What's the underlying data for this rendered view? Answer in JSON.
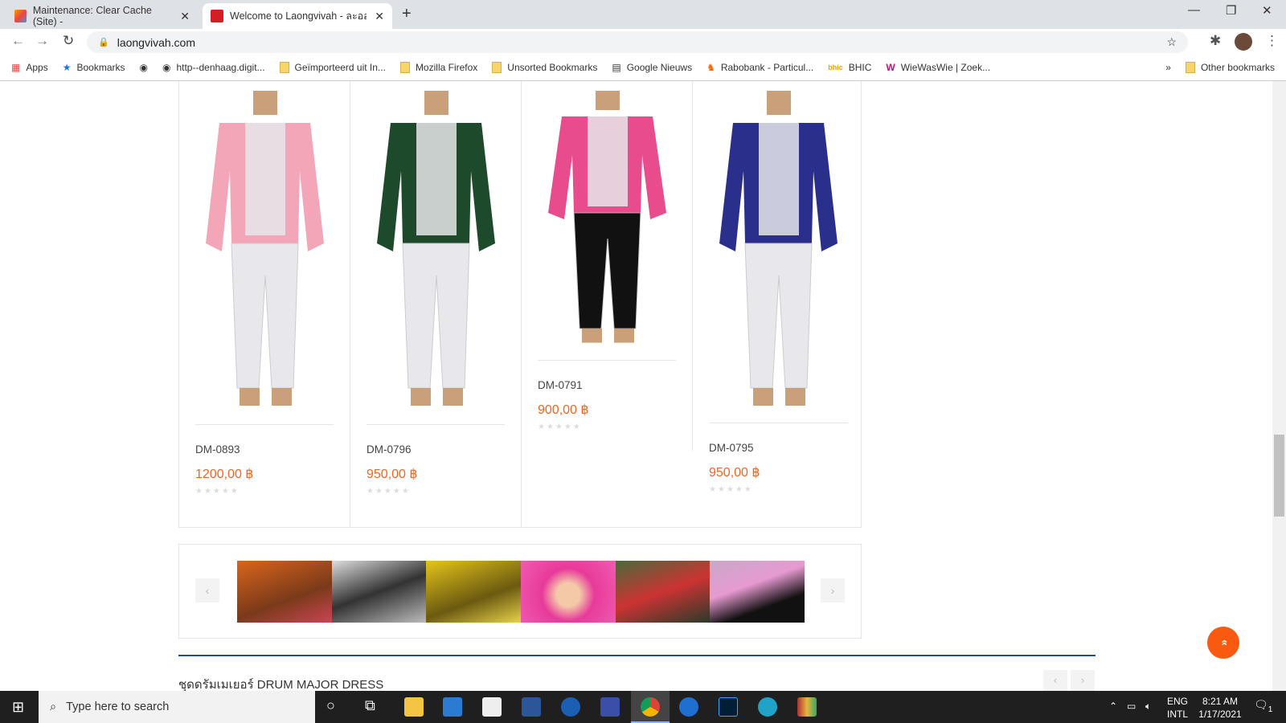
{
  "browser": {
    "tabs": [
      {
        "title": "Maintenance: Clear Cache (Site) -",
        "active": false
      },
      {
        "title": "Welcome to Laongvivah - ละอองฯ",
        "active": true
      }
    ],
    "url": "laongvivah.com",
    "bookmarks": [
      "Apps",
      "Bookmarks",
      "",
      "http--denhaag.digit...",
      "Geïmporteerd uit In...",
      "Mozilla Firefox",
      "Unsorted Bookmarks",
      "Google Nieuws",
      "Rabobank - Particul...",
      "BHIC",
      "WieWasWie | Zoek..."
    ],
    "other_bookmarks": "Other bookmarks"
  },
  "products": [
    {
      "code": "DM-0893",
      "price": "1200,00 ฿",
      "jacket": "#f2a6b8",
      "pants": "#e8e8ec",
      "rating": 0
    },
    {
      "code": "DM-0796",
      "price": "950,00 ฿",
      "jacket": "#1d4a2a",
      "pants": "#e8e8ec",
      "rating": 0
    },
    {
      "code": "DM-0791",
      "price": "900,00 ฿",
      "jacket": "#e84c8c",
      "pants": "#111111",
      "rating": 0
    },
    {
      "code": "DM-0795",
      "price": "950,00 ฿",
      "jacket": "#2a2f8c",
      "pants": "#e8e8ec",
      "rating": 0
    }
  ],
  "carousel": {
    "prev": "‹",
    "next": "›"
  },
  "section": {
    "title": "ชุดดรัมเมเยอร์ DRUM MAJOR DRESS",
    "prev": "‹",
    "next": "›"
  },
  "back_to_top": "»",
  "taskbar": {
    "search_placeholder": "Type here to search",
    "lang1": "ENG",
    "lang2": "INTL",
    "time": "8:21 AM",
    "date": "1/17/2021",
    "notifications": "1"
  },
  "colors": {
    "accent": "#f26522",
    "section_line": "#1f4e8c"
  }
}
